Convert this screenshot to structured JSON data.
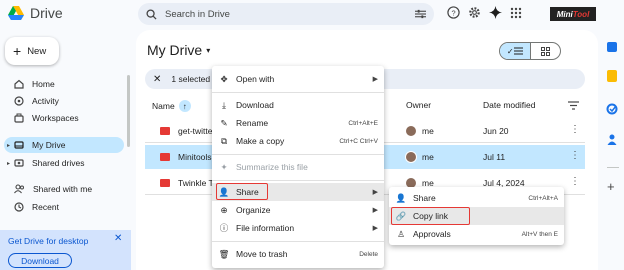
{
  "header": {
    "app_name": "Drive",
    "search_placeholder": "Search in Drive",
    "brand": {
      "part1": "Mini",
      "part2": "Tool"
    }
  },
  "sidebar": {
    "new_label": "New",
    "items": [
      {
        "label": "Home",
        "icon": "home-icon"
      },
      {
        "label": "Activity",
        "icon": "activity-icon"
      },
      {
        "label": "Workspaces",
        "icon": "workspaces-icon"
      },
      {
        "label": "My Drive",
        "icon": "my-drive-icon",
        "active": true
      },
      {
        "label": "Shared drives",
        "icon": "shared-drives-icon"
      },
      {
        "label": "Shared with me",
        "icon": "people-icon"
      },
      {
        "label": "Recent",
        "icon": "clock-icon"
      }
    ],
    "promo": {
      "title": "Get Drive for desktop",
      "button": "Download"
    }
  },
  "main": {
    "title": "My Drive",
    "selection_text": "1 selected",
    "columns": {
      "name": "Name",
      "owner": "Owner",
      "modified": "Date modified"
    },
    "rows": [
      {
        "name": "get-twitte",
        "owner": "me",
        "modified": "Jun 20",
        "selected": false
      },
      {
        "name": "Minitools",
        "owner": "me",
        "modified": "Jul 11",
        "selected": true
      },
      {
        "name": "Twinkle T",
        "owner": "me",
        "modified": "Jul 4, 2024",
        "selected": false
      }
    ]
  },
  "context_menu": {
    "items": [
      {
        "label": "Open with",
        "icon": "open-with-icon",
        "shortcut": "",
        "submenu": true
      },
      {
        "label": "Download",
        "icon": "download-icon",
        "shortcut": ""
      },
      {
        "label": "Rename",
        "icon": "rename-icon",
        "shortcut": "Ctrl+Alt+E"
      },
      {
        "label": "Make a copy",
        "icon": "copy-icon",
        "shortcut": "Ctrl+C Ctrl+V"
      },
      {
        "label": "Summarize this file",
        "icon": "sparkle-icon",
        "shortcut": "",
        "disabled": true
      },
      {
        "label": "Share",
        "icon": "share-icon",
        "shortcut": "",
        "submenu": true,
        "highlighted": true
      },
      {
        "label": "Organize",
        "icon": "organize-icon",
        "shortcut": "",
        "submenu": true
      },
      {
        "label": "File information",
        "icon": "info-icon",
        "shortcut": "",
        "submenu": true
      },
      {
        "label": "Move to trash",
        "icon": "trash-icon",
        "shortcut": "Delete"
      }
    ]
  },
  "share_submenu": {
    "items": [
      {
        "label": "Share",
        "icon": "share-icon",
        "shortcut": "Ctrl+Alt+A"
      },
      {
        "label": "Copy link",
        "icon": "link-icon",
        "shortcut": "",
        "highlighted": true
      },
      {
        "label": "Approvals",
        "icon": "approvals-icon",
        "shortcut": "Alt+V then E"
      }
    ]
  },
  "colors": {
    "accent": "#0b57d0",
    "selection": "#c2e7ff",
    "annotation": "#e53935"
  }
}
